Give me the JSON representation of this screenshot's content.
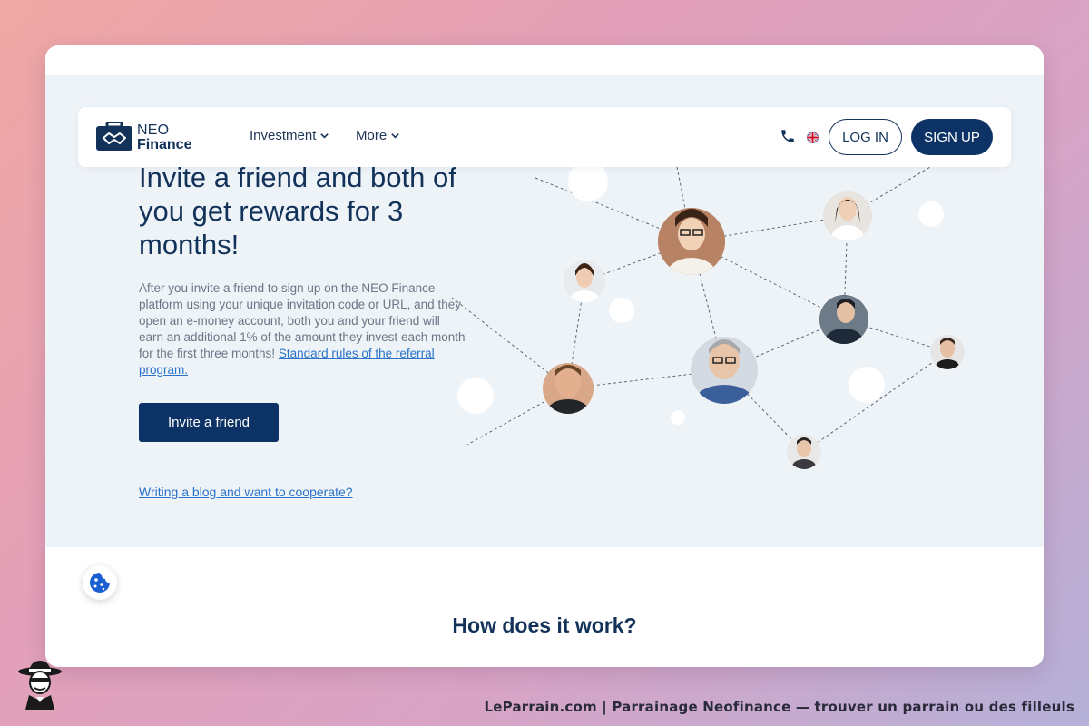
{
  "header": {
    "logo_line1": "NEO",
    "logo_line2": "Finance",
    "nav": [
      {
        "label": "Investment"
      },
      {
        "label": "More"
      }
    ],
    "login_label": "LOG IN",
    "signup_label": "SIGN UP"
  },
  "hero": {
    "title": "Invite a friend and both of you get rewards for 3 months!",
    "description": "After you invite a friend to sign up on the NEO Finance platform using your unique invitation code or URL, and they open an e-money account, both you and your friend will earn an additional 1% of the amount they invest each month for the first three months!",
    "rules_link": "Standard rules of the referral program.",
    "invite_button": "Invite a friend",
    "blog_link": "Writing a blog and want to cooperate?"
  },
  "section": {
    "how_title": "How does it work?"
  },
  "footer": {
    "caption": "LeParrain.com | Parrainage Neofinance — trouver un parrain ou des filleuls"
  },
  "colors": {
    "brand_navy": "#0d3366",
    "link_blue": "#2b73c9",
    "hero_bg": "#eef3f8"
  },
  "icons": [
    "briefcase-handshake-logo-icon",
    "chevron-down-icon",
    "phone-icon",
    "uk-flag-icon",
    "cookie-icon",
    "mascot-icon"
  ]
}
